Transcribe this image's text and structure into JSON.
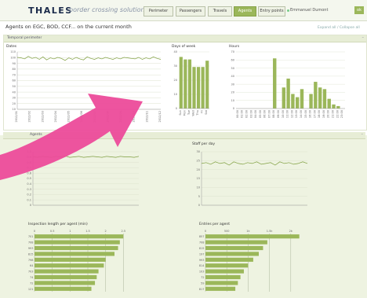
{
  "app": {
    "brand": "THALES",
    "brand_sub": "border crossing solution"
  },
  "nav": [
    {
      "label": "Perimeter",
      "active": false
    },
    {
      "label": "Passengers",
      "active": false
    },
    {
      "label": "Travels",
      "active": false
    },
    {
      "label": "Agents",
      "active": true
    },
    {
      "label": "Entry points",
      "active": false
    }
  ],
  "user": {
    "name": "Emmanuel Dumont",
    "logout": "ok"
  },
  "page": {
    "title": "Agents on EGC, BOD, CCF... on the current month",
    "expand": "Expand all / Collapse all"
  },
  "section1": {
    "title": "Temporal perimeter"
  },
  "section2": {
    "title": "Agents"
  },
  "colors": {
    "bar": "#9bb75a",
    "line": "#7f9f3f",
    "accent": "#ec4b9a"
  },
  "chart_data": [
    {
      "type": "line",
      "title": "Dates",
      "yticks": [
        "110",
        "100",
        "90",
        "80",
        "70",
        "60",
        "50",
        "40",
        "30",
        "20",
        "10"
      ],
      "xticks": [
        "2012/01",
        "2012/02",
        "2012/03",
        "2012/04",
        "2012/05",
        "2012/06",
        "2012/07",
        "2012/08",
        "2012/09",
        "2012/10",
        "2012/11",
        "2012/12"
      ],
      "values": [
        104,
        103,
        101,
        106,
        102,
        104,
        100,
        105,
        99,
        103,
        101,
        104,
        102,
        98,
        103,
        100,
        104,
        101,
        99,
        105,
        102,
        100,
        103,
        101,
        104,
        102,
        100,
        103,
        101,
        104,
        103,
        102,
        101,
        104,
        100,
        103,
        101,
        105,
        102,
        100
      ],
      "ylim": [
        0,
        115
      ]
    },
    {
      "type": "bar",
      "title": "Days of week",
      "categories": [
        "Sun",
        "Mon",
        "Tue",
        "Wed",
        "Thu",
        "Fri",
        "Sat"
      ],
      "values": [
        41,
        39,
        39,
        33,
        33,
        33,
        38
      ],
      "yticks": [
        "40",
        "30",
        "20",
        "10",
        "0"
      ],
      "ylim": [
        0,
        45
      ]
    },
    {
      "type": "bar",
      "title": "Hours",
      "categories": [
        "00:00",
        "01:00",
        "02:00",
        "03:00",
        "04:00",
        "05:00",
        "06:00",
        "07:00",
        "08:00",
        "09:00",
        "10:00",
        "11:00",
        "12:00",
        "13:00",
        "14:00",
        "15:00",
        "16:00",
        "17:00",
        "18:00",
        "19:00",
        "20:00",
        "21:00",
        "22:00",
        "23:00"
      ],
      "values": [
        0,
        0,
        0,
        0,
        0,
        0,
        0,
        0,
        62,
        0,
        26,
        37,
        18,
        14,
        24,
        0,
        18,
        33,
        26,
        24,
        12,
        5,
        3,
        0
      ],
      "yticks": [
        "70",
        "60",
        "50",
        "40",
        "30",
        "20",
        "10",
        "0"
      ],
      "ylim": [
        0,
        70
      ]
    },
    {
      "type": "line",
      "title": "",
      "yticks": [
        "1.0",
        "0.9",
        "0.8",
        "0.7",
        "0.6",
        "0.5",
        "0.4",
        "0.3",
        "0.2",
        "0.1",
        "0"
      ],
      "values": [
        0.95,
        0.94,
        0.96,
        0.95,
        0.94,
        0.96,
        0.95,
        0.97,
        0.94,
        0.95,
        0.96,
        0.94,
        0.95,
        0.96,
        0.95,
        0.94,
        0.96,
        0.95,
        0.94,
        0.96,
        0.95,
        0.95,
        0.94,
        0.96
      ],
      "ylim": [
        0,
        1.05
      ]
    },
    {
      "type": "line",
      "title": "Staff per day",
      "yticks": [
        "30",
        "25",
        "20",
        "15",
        "10",
        "5",
        "0"
      ],
      "values": [
        25,
        25.5,
        24.5,
        26,
        25,
        25.5,
        24,
        26,
        25,
        24.5,
        25.5,
        25,
        26,
        24.5,
        25,
        25.5,
        24,
        26,
        25,
        25.5,
        24.5,
        25,
        26,
        25
      ],
      "ylim": [
        0,
        32
      ]
    },
    {
      "type": "bar",
      "title": "Inspection length per agent (min)",
      "orientation": "horizontal",
      "xticks": [
        "0",
        "0.5",
        "1",
        "1.5",
        "2",
        "2.5"
      ],
      "categories": [
        "701",
        "708",
        "993",
        "815",
        "798",
        "64",
        "703",
        "74",
        "72",
        "121"
      ],
      "values": [
        2.5,
        2.4,
        2.35,
        2.25,
        2.0,
        1.95,
        1.8,
        1.75,
        1.7,
        1.6
      ],
      "xlim": [
        0,
        3
      ]
    },
    {
      "type": "bar",
      "title": "Entries per agent",
      "orientation": "horizontal",
      "xticks": [
        "0",
        "500",
        "1k",
        "1.5k",
        "2k"
      ],
      "categories": [
        "857",
        "708",
        "815",
        "197",
        "993",
        "814",
        "103",
        "72",
        "59",
        "817"
      ],
      "values": [
        2200,
        1450,
        1350,
        1250,
        1120,
        1000,
        900,
        820,
        760,
        700
      ],
      "xlim": [
        0,
        2500
      ]
    }
  ]
}
